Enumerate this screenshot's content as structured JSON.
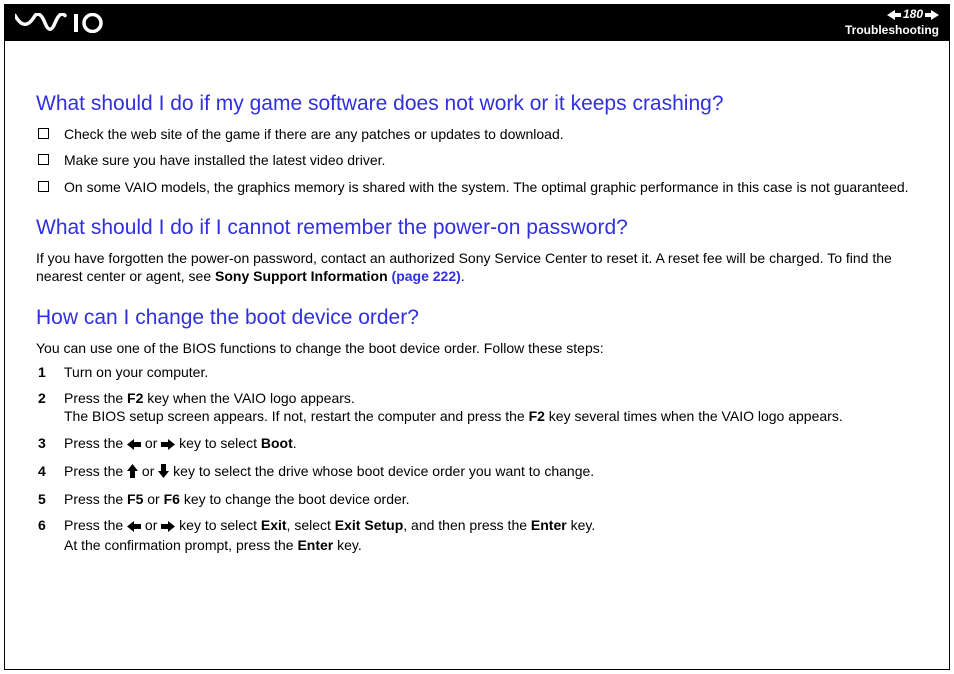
{
  "header": {
    "page_number": "180",
    "section": "Troubleshooting"
  },
  "q1": {
    "title": "What should I do if my game software does not work or it keeps crashing?",
    "bullets": [
      "Check the web site of the game if there are any patches or updates to download.",
      "Make sure you have installed the latest video driver.",
      "On some VAIO models, the graphics memory is shared with the system. The optimal graphic performance in this case is not guaranteed."
    ]
  },
  "q2": {
    "title": "What should I do if I cannot remember the power-on password?",
    "para_pre": "If you have forgotten the power-on password, contact an authorized Sony Service Center to reset it. A reset fee will be charged. To find the nearest center or agent, see ",
    "link_bold": "Sony Support Information ",
    "link_page": "(page 222)",
    "para_post": "."
  },
  "q3": {
    "title": "How can I change the boot device order?",
    "intro": "You can use one of the BIOS functions to change the boot device order. Follow these steps:",
    "steps": {
      "s1": "Turn on your computer.",
      "s2a": "Press the ",
      "s2_key": "F2",
      "s2b": " key when the VAIO logo appears.",
      "s2c": "The BIOS setup screen appears. If not, restart the computer and press the ",
      "s2d": " key several times when the VAIO logo appears.",
      "s3a": "Press the ",
      "s3_or": " or ",
      "s3b": " key to select ",
      "s3_boot": "Boot",
      "s3c": ".",
      "s4a": "Press the ",
      "s4b": " key to select the drive whose boot device order you want to change.",
      "s5a": "Press the ",
      "s5_f5": "F5",
      "s5_or": " or ",
      "s5_f6": "F6",
      "s5b": " key to change the boot device order.",
      "s6a": "Press the ",
      "s6b": " key to select ",
      "s6_exit": "Exit",
      "s6c": ", select ",
      "s6_exitsetup": "Exit Setup",
      "s6d": ", and then press the ",
      "s6_enter": "Enter",
      "s6e": " key.",
      "s6f": "At the confirmation prompt, press the ",
      "s6g": " key."
    }
  }
}
